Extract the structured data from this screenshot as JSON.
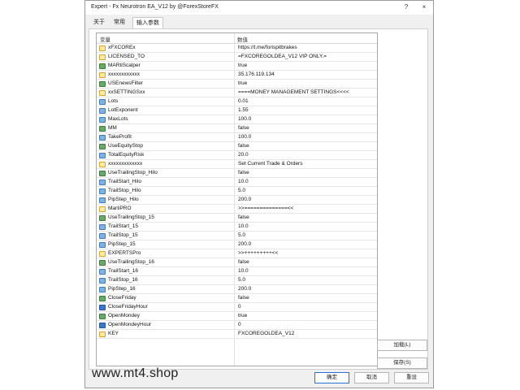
{
  "window": {
    "title": "Expert - Fx Neurotron EA_V12 by @ForexStoreFX",
    "help_button": "?",
    "close_button": "×"
  },
  "tabs": [
    {
      "label": "关于"
    },
    {
      "label": "常用"
    },
    {
      "label": "输入参数"
    }
  ],
  "grid": {
    "header_name": "变量",
    "header_value": "数值",
    "rows": [
      {
        "icon": "v",
        "name": "xFXCOREx",
        "value": "https://t.me/forispitbrakes"
      },
      {
        "icon": "v",
        "name": "LICENSED_TO",
        "value": "=FXCOREGOLDEA_V12 VIP ONLY.="
      },
      {
        "icon": "b",
        "name": "MARtiScalper",
        "value": "true"
      },
      {
        "icon": "v",
        "name": "xxxxxxxxxxxx",
        "value": "35.176.119.134"
      },
      {
        "icon": "b",
        "name": "USEnewsFilter",
        "value": "true"
      },
      {
        "icon": "v",
        "name": "xxSETTINGSxx",
        "value": "====MONEY MANAGEMENT SETTINGS<<<<"
      },
      {
        "icon": "n",
        "name": "Lots",
        "value": "0.01"
      },
      {
        "icon": "n",
        "name": "LotExponent",
        "value": "1.55"
      },
      {
        "icon": "n",
        "name": "MaxLots",
        "value": "100.0"
      },
      {
        "icon": "b",
        "name": "MM",
        "value": "false"
      },
      {
        "icon": "n",
        "name": "TakeProfit",
        "value": "100.0"
      },
      {
        "icon": "b",
        "name": "UseEquityStop",
        "value": "false"
      },
      {
        "icon": "n",
        "name": "TotalEquityRisk",
        "value": "20.0"
      },
      {
        "icon": "v",
        "name": "xxxxxxxxxxxxx",
        "value": "Set Current Trade & Orders"
      },
      {
        "icon": "b",
        "name": "UseTrailingStop_Hilo",
        "value": "false"
      },
      {
        "icon": "n",
        "name": "TrailStart_Hilo",
        "value": "10.0"
      },
      {
        "icon": "n",
        "name": "TrailStop_Hilo",
        "value": "5.0"
      },
      {
        "icon": "n",
        "name": "PipStep_Hilo",
        "value": "200.0"
      },
      {
        "icon": "v",
        "name": "MartiPRO",
        "value": ">>==============<<"
      },
      {
        "icon": "b",
        "name": "UseTrailingStop_15",
        "value": "false"
      },
      {
        "icon": "n",
        "name": "TrailStart_15",
        "value": "10.0"
      },
      {
        "icon": "n",
        "name": "TrailStop_15",
        "value": "5.0"
      },
      {
        "icon": "n",
        "name": "PipStep_15",
        "value": "200.0"
      },
      {
        "icon": "v",
        "name": "EXPERTSPro",
        "value": ">>+++++++++<<"
      },
      {
        "icon": "b",
        "name": "UseTrailingStop_16",
        "value": "false"
      },
      {
        "icon": "n",
        "name": "TrailStart_16",
        "value": "10.0"
      },
      {
        "icon": "n",
        "name": "TrailStop_16",
        "value": "5.0"
      },
      {
        "icon": "n",
        "name": "PipStep_16",
        "value": "200.0"
      },
      {
        "icon": "b",
        "name": "CloseFriday",
        "value": "false"
      },
      {
        "icon": "t",
        "name": "CloseFridayHour",
        "value": "0"
      },
      {
        "icon": "b",
        "name": "OpenMondey",
        "value": "true"
      },
      {
        "icon": "t",
        "name": "OpenMondeyHour",
        "value": "0"
      },
      {
        "icon": "v",
        "name": "KEY",
        "value": "FXCOREGOLDEA_V12"
      }
    ]
  },
  "side_buttons": {
    "load": "加载(L)",
    "save": "保存(S)"
  },
  "bottom_buttons": {
    "ok": "确定",
    "cancel": "取消",
    "reset": "重设"
  },
  "watermark": "www.mt4.shop"
}
